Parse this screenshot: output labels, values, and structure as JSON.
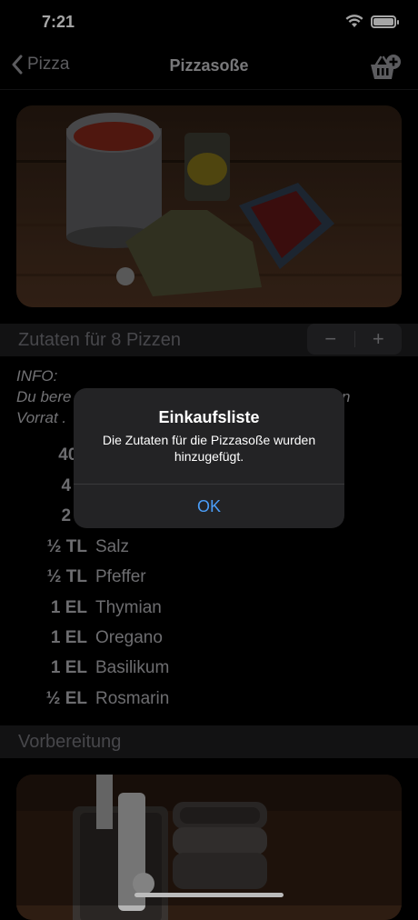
{
  "status_bar": {
    "time": "7:21"
  },
  "nav": {
    "back_label": "Pizza",
    "title": "Pizzasoße"
  },
  "servings": {
    "label": "Zutaten für 8 Pizzen",
    "minus": "−",
    "plus": "+"
  },
  "info": {
    "line1": "INFO:",
    "line2": "Du bere",
    "line2_end": "n",
    "line3": "Vorrat ."
  },
  "ingredients": [
    {
      "amount": "400",
      "name": ""
    },
    {
      "amount": "4 E",
      "name": ""
    },
    {
      "amount": "2 E",
      "name": ""
    },
    {
      "amount": "½ TL",
      "name": "Salz"
    },
    {
      "amount": "½ TL",
      "name": "Pfeffer"
    },
    {
      "amount": "1 EL",
      "name": "Thymian"
    },
    {
      "amount": "1 EL",
      "name": "Oregano"
    },
    {
      "amount": "1 EL",
      "name": "Basilikum"
    },
    {
      "amount": "½ EL",
      "name": "Rosmarin"
    }
  ],
  "preparation": {
    "title": "Vorbereitung"
  },
  "alert": {
    "title": "Einkaufsliste",
    "message": "Die Zutaten für die Pizzasoße wurden hinzugefügt.",
    "ok": "OK"
  }
}
